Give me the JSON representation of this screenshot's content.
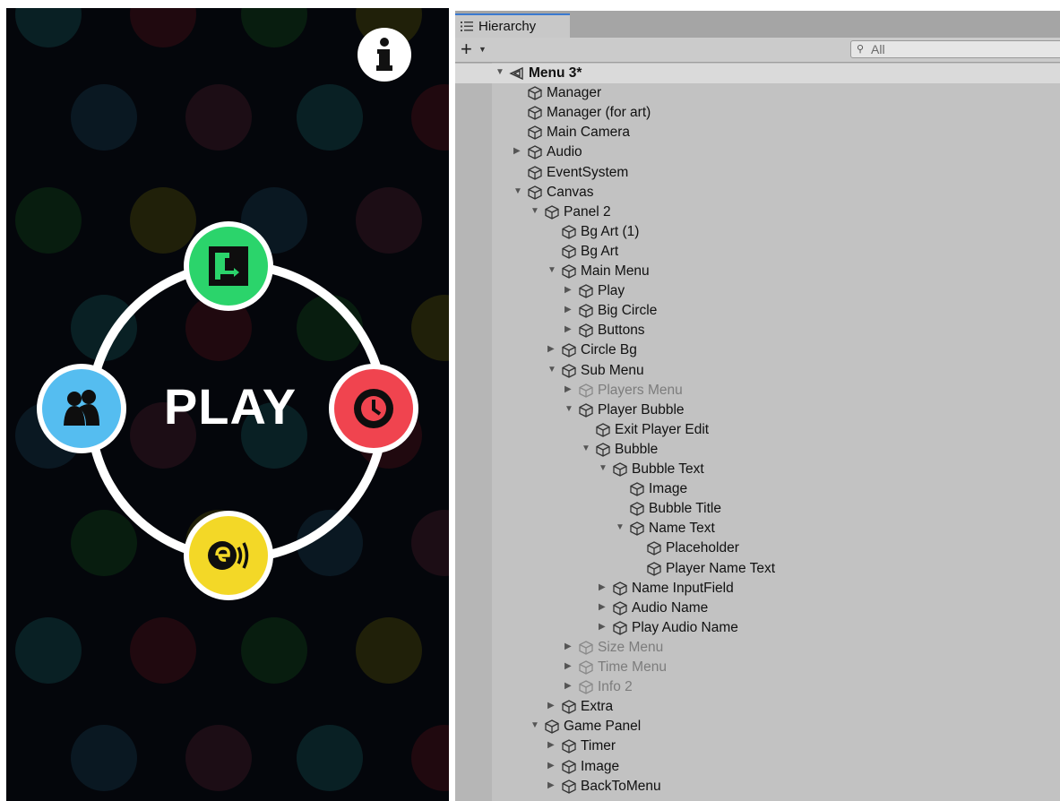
{
  "game": {
    "play_label": "PLAY",
    "info_icon": "info-icon",
    "colors": {
      "green": "#2bd46b",
      "blue": "#55bdf0",
      "red": "#f0444f",
      "yellow": "#f3d827",
      "background": "#04060b"
    }
  },
  "hierarchy": {
    "tab_label": "Hierarchy",
    "add_label": "+",
    "search_placeholder": "All",
    "rows": [
      {
        "label": "Menu 3*",
        "depth": 0,
        "fold": "open",
        "kind": "scene"
      },
      {
        "label": "Manager",
        "depth": 1,
        "fold": "none"
      },
      {
        "label": "Manager (for art)",
        "depth": 1,
        "fold": "none"
      },
      {
        "label": "Main Camera",
        "depth": 1,
        "fold": "none"
      },
      {
        "label": "Audio",
        "depth": 1,
        "fold": "closed"
      },
      {
        "label": "EventSystem",
        "depth": 1,
        "fold": "none"
      },
      {
        "label": "Canvas",
        "depth": 1,
        "fold": "open"
      },
      {
        "label": "Panel 2",
        "depth": 2,
        "fold": "open"
      },
      {
        "label": "Bg Art (1)",
        "depth": 3,
        "fold": "none"
      },
      {
        "label": "Bg Art",
        "depth": 3,
        "fold": "none"
      },
      {
        "label": "Main Menu",
        "depth": 3,
        "fold": "open"
      },
      {
        "label": "Play",
        "depth": 4,
        "fold": "closed"
      },
      {
        "label": "Big Circle",
        "depth": 4,
        "fold": "closed"
      },
      {
        "label": "Buttons",
        "depth": 4,
        "fold": "closed"
      },
      {
        "label": "Circle Bg",
        "depth": 3,
        "fold": "closed"
      },
      {
        "label": "Sub Menu",
        "depth": 3,
        "fold": "open"
      },
      {
        "label": "Players Menu",
        "depth": 4,
        "fold": "closed",
        "inactive": true
      },
      {
        "label": "Player Bubble",
        "depth": 4,
        "fold": "open"
      },
      {
        "label": "Exit Player Edit",
        "depth": 5,
        "fold": "none"
      },
      {
        "label": "Bubble",
        "depth": 5,
        "fold": "open"
      },
      {
        "label": "Bubble Text",
        "depth": 6,
        "fold": "open"
      },
      {
        "label": "Image",
        "depth": 7,
        "fold": "none"
      },
      {
        "label": "Bubble Title",
        "depth": 7,
        "fold": "none"
      },
      {
        "label": "Name Text",
        "depth": 7,
        "fold": "open"
      },
      {
        "label": "Placeholder",
        "depth": 8,
        "fold": "none"
      },
      {
        "label": "Player Name Text",
        "depth": 8,
        "fold": "none"
      },
      {
        "label": "Name InputField",
        "depth": 6,
        "fold": "closed"
      },
      {
        "label": "Audio Name",
        "depth": 6,
        "fold": "closed"
      },
      {
        "label": "Play Audio Name",
        "depth": 6,
        "fold": "closed"
      },
      {
        "label": "Size Menu",
        "depth": 4,
        "fold": "closed",
        "inactive": true
      },
      {
        "label": "Time Menu",
        "depth": 4,
        "fold": "closed",
        "inactive": true
      },
      {
        "label": "Info 2",
        "depth": 4,
        "fold": "closed",
        "inactive": true
      },
      {
        "label": "Extra",
        "depth": 3,
        "fold": "closed"
      },
      {
        "label": "Game Panel",
        "depth": 2,
        "fold": "open"
      },
      {
        "label": "Timer",
        "depth": 3,
        "fold": "closed"
      },
      {
        "label": "Image",
        "depth": 3,
        "fold": "closed"
      },
      {
        "label": "BackToMenu",
        "depth": 3,
        "fold": "closed"
      }
    ]
  }
}
